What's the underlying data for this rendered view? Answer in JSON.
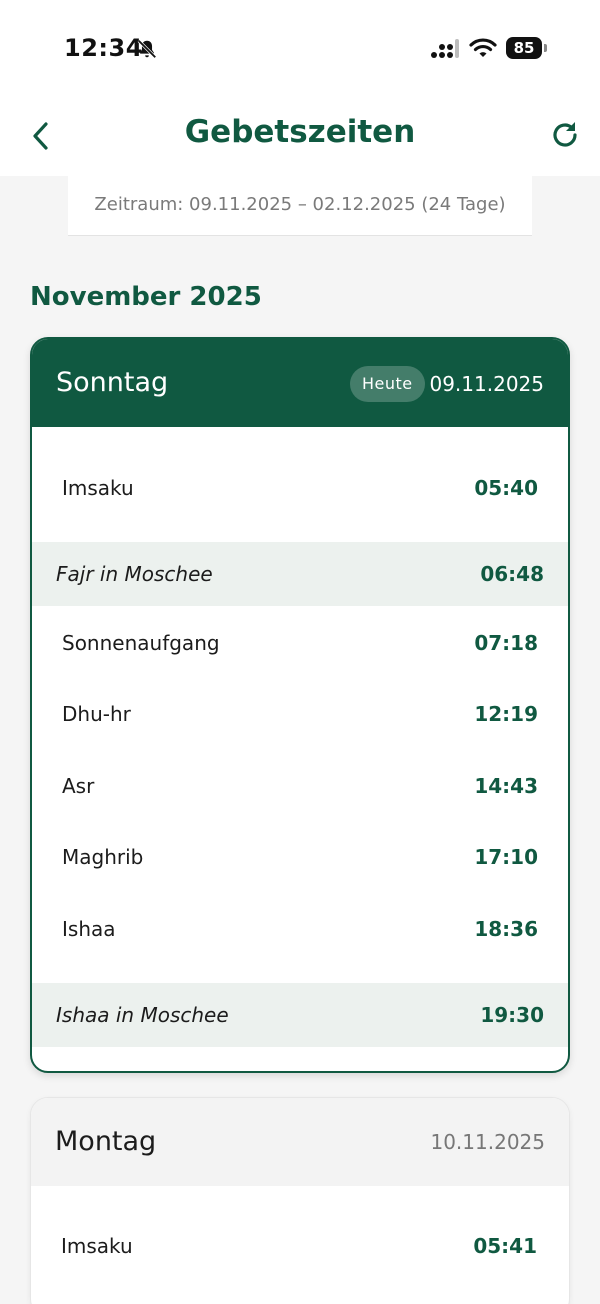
{
  "status_bar": {
    "time": "12:34",
    "battery": "85"
  },
  "header": {
    "title": "Gebetszeiten"
  },
  "range": {
    "label": "Zeitraum: 09.11.2025 – 02.12.2025 (24 Tage)"
  },
  "month": {
    "title": "November 2025"
  },
  "days": [
    {
      "name": "Sonntag",
      "badge": "Heute",
      "date": "09.11.2025",
      "prayers": [
        {
          "name": "Imsaku",
          "time": "05:40"
        },
        {
          "name": "Fajr in Moschee",
          "time": "06:48"
        },
        {
          "name": "Sonnenaufgang",
          "time": "07:18"
        },
        {
          "name": "Dhu-hr",
          "time": "12:19"
        },
        {
          "name": "Asr",
          "time": "14:43"
        },
        {
          "name": "Maghrib",
          "time": "17:10"
        },
        {
          "name": "Ishaa",
          "time": "18:36"
        },
        {
          "name": "Ishaa in Moschee",
          "time": "19:30"
        }
      ]
    },
    {
      "name": "Montag",
      "date": "10.11.2025",
      "prayers": [
        {
          "name": "Imsaku",
          "time": "05:41"
        }
      ]
    }
  ],
  "colors": {
    "brand": "#105941",
    "highlight_row": "#ecf1ee"
  },
  "icons": {
    "back": "chevron-left-icon",
    "refresh": "refresh-icon",
    "bell": "bell-slash-icon",
    "wifi": "wifi-icon",
    "signal": "cellular-signal-icon",
    "battery": "battery-icon"
  }
}
